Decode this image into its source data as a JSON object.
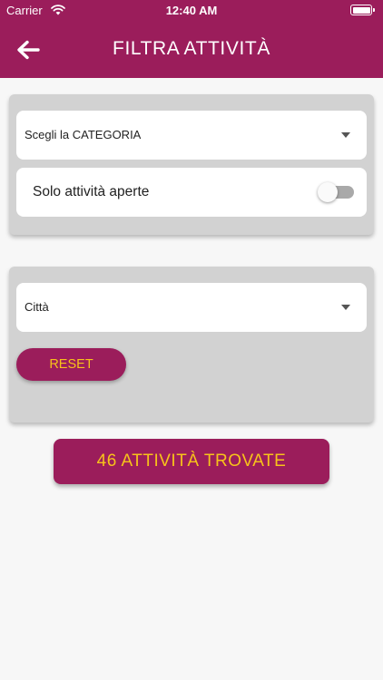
{
  "colors": {
    "primary": "#9b1d5b",
    "accent": "#f7c31a",
    "card_background": "#d2d2d2",
    "page_background": "#f7f7f7"
  },
  "status_bar": {
    "carrier": "Carrier",
    "time": "12:40 AM",
    "icons": [
      "wifi-icon",
      "battery-icon"
    ]
  },
  "nav": {
    "back_icon": "arrow-left-icon",
    "title": "FILTRA ATTIVITÀ"
  },
  "filters": {
    "category": {
      "value": "Scegli la CATEGORIA",
      "icon": "caret-down-icon"
    },
    "open_only": {
      "label": "Solo attività aperte",
      "enabled": false
    }
  },
  "location": {
    "city": {
      "value": "Città",
      "icon": "caret-down-icon"
    },
    "reset_label": "RESET"
  },
  "results": {
    "label": "46 ATTIVITÀ TROVATE"
  }
}
